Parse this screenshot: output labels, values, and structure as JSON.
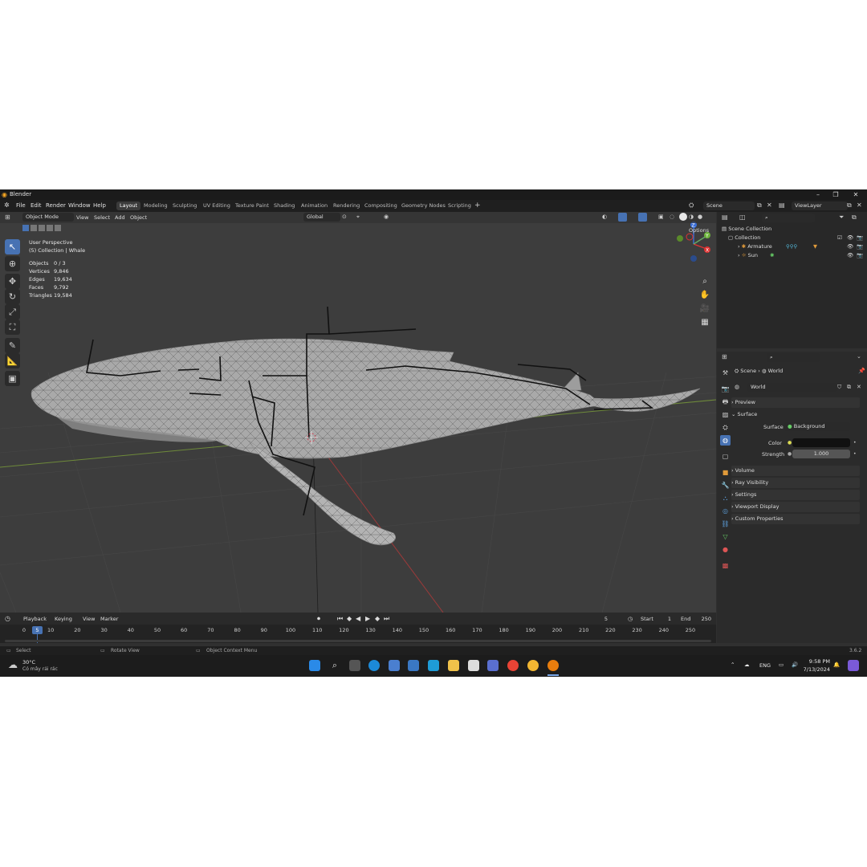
{
  "window": {
    "title": "Blender",
    "version": "3.6.2"
  },
  "menu": [
    "File",
    "Edit",
    "Render",
    "Window",
    "Help"
  ],
  "workspaces": [
    "Layout",
    "Modeling",
    "Sculpting",
    "UV Editing",
    "Texture Paint",
    "Shading",
    "Animation",
    "Rendering",
    "Compositing",
    "Geometry Nodes",
    "Scripting"
  ],
  "active_workspace": "Layout",
  "scene_field": "Scene",
  "viewlayer_field": "ViewLayer",
  "viewport": {
    "mode": "Object Mode",
    "menus": [
      "View",
      "Select",
      "Add",
      "Object"
    ],
    "transform": "Global",
    "options": "Options",
    "perspective": "User Perspective",
    "collection_path": "(5) Collection | Whale",
    "stats": [
      {
        "label": "Objects",
        "value": "0 / 3"
      },
      {
        "label": "Vertices",
        "value": "9,846"
      },
      {
        "label": "Edges",
        "value": "19,634"
      },
      {
        "label": "Faces",
        "value": "9,792"
      },
      {
        "label": "Triangles",
        "value": "19,584"
      }
    ],
    "gizmo_axes": [
      "Z",
      "X",
      "Y"
    ]
  },
  "outliner": {
    "root": "Scene Collection",
    "collection": "Collection",
    "items": [
      "Armature",
      "Sun"
    ]
  },
  "properties": {
    "breadcrumb_scene": "Scene",
    "breadcrumb_world": "World",
    "world_name": "World",
    "sections": [
      "Preview",
      "Surface",
      "Volume",
      "Ray Visibility",
      "Settings",
      "Viewport Display",
      "Custom Properties"
    ],
    "surface_label": "Surface",
    "surface_value": "Background",
    "color_label": "Color",
    "strength_label": "Strength",
    "strength_value": "1.000"
  },
  "timeline": {
    "menus": [
      "Playback",
      "Keying",
      "View",
      "Marker"
    ],
    "current_frame": "5",
    "start_label": "Start",
    "start_value": "1",
    "end_label": "End",
    "end_value": "250",
    "ticks": [
      "0",
      "10",
      "20",
      "30",
      "40",
      "50",
      "60",
      "70",
      "80",
      "90",
      "100",
      "110",
      "120",
      "130",
      "140",
      "150",
      "160",
      "170",
      "180",
      "190",
      "200",
      "210",
      "220",
      "230",
      "240",
      "250"
    ],
    "playhead_label": "5"
  },
  "statusbar": {
    "select": "Select",
    "rotate": "Rotate View",
    "context": "Object Context Menu"
  },
  "taskbar": {
    "weather_temp": "30°C",
    "weather_desc": "Có mây rải rác",
    "lang": "ENG",
    "time": "9:58 PM",
    "date": "7/13/2024"
  },
  "colors": {
    "accent": "#4772b3",
    "background": "#303030",
    "viewport": "#3d3d3d"
  }
}
